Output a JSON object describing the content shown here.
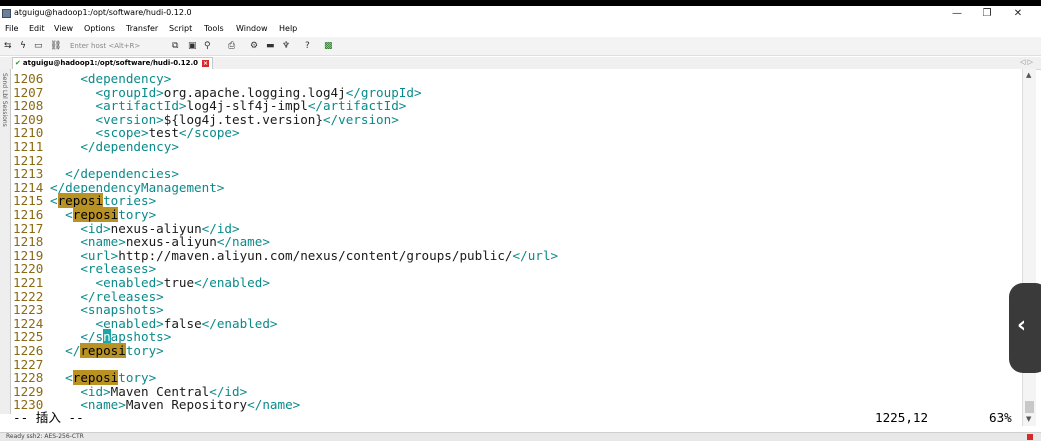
{
  "window": {
    "title": "atguigu@hadoop1:/opt/software/hudi-0.12.0",
    "controls": {
      "minimize": "—",
      "restore": "❐",
      "close": "✕"
    }
  },
  "menu": [
    "File",
    "Edit",
    "View",
    "Options",
    "Transfer",
    "Script",
    "Tools",
    "Window",
    "Help"
  ],
  "toolbar": {
    "host_placeholder": "Enter host <Alt+R>",
    "icons": [
      "connect-icon",
      "lightning-icon",
      "reconnect-icon",
      "link-icon",
      "copy-icon",
      "paste-icon",
      "find-icon",
      "print-icon",
      "settings-icon",
      "keymap-icon",
      "key-icon",
      "help-icon",
      "monitor-icon"
    ]
  },
  "tab": {
    "label": "atguigu@hadoop1:/opt/software/hudi-0.12.0",
    "close": "×",
    "arrows": "◁ ▷"
  },
  "side_panel_label": "Send Lbl Sessions",
  "editor": {
    "lines": [
      {
        "n": "1206",
        "segs": [
          [
            "t",
            "    <dependency>"
          ]
        ]
      },
      {
        "n": "1207",
        "segs": [
          [
            "t",
            "      <groupId>"
          ],
          [
            "v",
            "org.apache.logging.log4j"
          ],
          [
            "t",
            "</groupId>"
          ]
        ]
      },
      {
        "n": "1208",
        "segs": [
          [
            "t",
            "      <artifactId>"
          ],
          [
            "v",
            "log4j-slf4j-impl"
          ],
          [
            "t",
            "</artifactId>"
          ]
        ]
      },
      {
        "n": "1209",
        "segs": [
          [
            "t",
            "      <version>"
          ],
          [
            "v",
            "${log4j.test.version}"
          ],
          [
            "t",
            "</version>"
          ]
        ]
      },
      {
        "n": "1210",
        "segs": [
          [
            "t",
            "      <scope>"
          ],
          [
            "v",
            "test"
          ],
          [
            "t",
            "</scope>"
          ]
        ]
      },
      {
        "n": "1211",
        "segs": [
          [
            "t",
            "    </dependency>"
          ]
        ]
      },
      {
        "n": "1212",
        "segs": []
      },
      {
        "n": "1213",
        "segs": [
          [
            "t",
            "  </dependencies>"
          ]
        ]
      },
      {
        "n": "1214",
        "segs": [
          [
            "t",
            "</dependencyManagement>"
          ]
        ]
      },
      {
        "n": "1215",
        "segs": [
          [
            "t",
            "<"
          ],
          [
            "hl",
            "reposi"
          ],
          [
            "t",
            "tories>"
          ]
        ]
      },
      {
        "n": "1216",
        "segs": [
          [
            "t",
            "  <"
          ],
          [
            "hl",
            "reposi"
          ],
          [
            "t",
            "tory>"
          ]
        ]
      },
      {
        "n": "1217",
        "segs": [
          [
            "t",
            "    <id>"
          ],
          [
            "v",
            "nexus-aliyun"
          ],
          [
            "t",
            "</id>"
          ]
        ]
      },
      {
        "n": "1218",
        "segs": [
          [
            "t",
            "    <name>"
          ],
          [
            "v",
            "nexus-aliyun"
          ],
          [
            "t",
            "</name>"
          ]
        ]
      },
      {
        "n": "1219",
        "segs": [
          [
            "t",
            "    <url>"
          ],
          [
            "v",
            "http://maven.aliyun.com/nexus/content/groups/public/"
          ],
          [
            "t",
            "</url>"
          ]
        ]
      },
      {
        "n": "1220",
        "segs": [
          [
            "t",
            "    <releases>"
          ]
        ]
      },
      {
        "n": "1221",
        "segs": [
          [
            "t",
            "      <enabled>"
          ],
          [
            "v",
            "true"
          ],
          [
            "t",
            "</enabled>"
          ]
        ]
      },
      {
        "n": "1222",
        "segs": [
          [
            "t",
            "    </releases>"
          ]
        ]
      },
      {
        "n": "1223",
        "segs": [
          [
            "t",
            "    <snapshots>"
          ]
        ]
      },
      {
        "n": "1224",
        "segs": [
          [
            "t",
            "      <enabled>"
          ],
          [
            "v",
            "false"
          ],
          [
            "t",
            "</enabled>"
          ]
        ]
      },
      {
        "n": "1225",
        "segs": [
          [
            "t",
            "    </s"
          ],
          [
            "cur",
            "n"
          ],
          [
            "t",
            "apshots>"
          ]
        ]
      },
      {
        "n": "1226",
        "segs": [
          [
            "t",
            "  </"
          ],
          [
            "hl",
            "reposi"
          ],
          [
            "t",
            "tory>"
          ]
        ]
      },
      {
        "n": "1227",
        "segs": []
      },
      {
        "n": "1228",
        "segs": [
          [
            "t",
            "  <"
          ],
          [
            "hl",
            "reposi"
          ],
          [
            "t",
            "tory>"
          ]
        ]
      },
      {
        "n": "1229",
        "segs": [
          [
            "t",
            "    <id>"
          ],
          [
            "v",
            "Maven Central"
          ],
          [
            "t",
            "</id>"
          ]
        ]
      },
      {
        "n": "1230",
        "segs": [
          [
            "t",
            "    <name>"
          ],
          [
            "v",
            "Maven Repository"
          ],
          [
            "t",
            "</name>"
          ]
        ]
      }
    ]
  },
  "status": {
    "mode": "-- 插入 --",
    "position": "1225,12",
    "percent": "63%"
  },
  "bottom_bar": "Ready    ssh2: AES-256-CTR",
  "overlay": {
    "chevron": "‹"
  },
  "colors": {
    "tag": "#0a8a8a",
    "line_number": "#8a6a12",
    "highlight": "#b89222",
    "cursor": "#1aa7a7"
  }
}
